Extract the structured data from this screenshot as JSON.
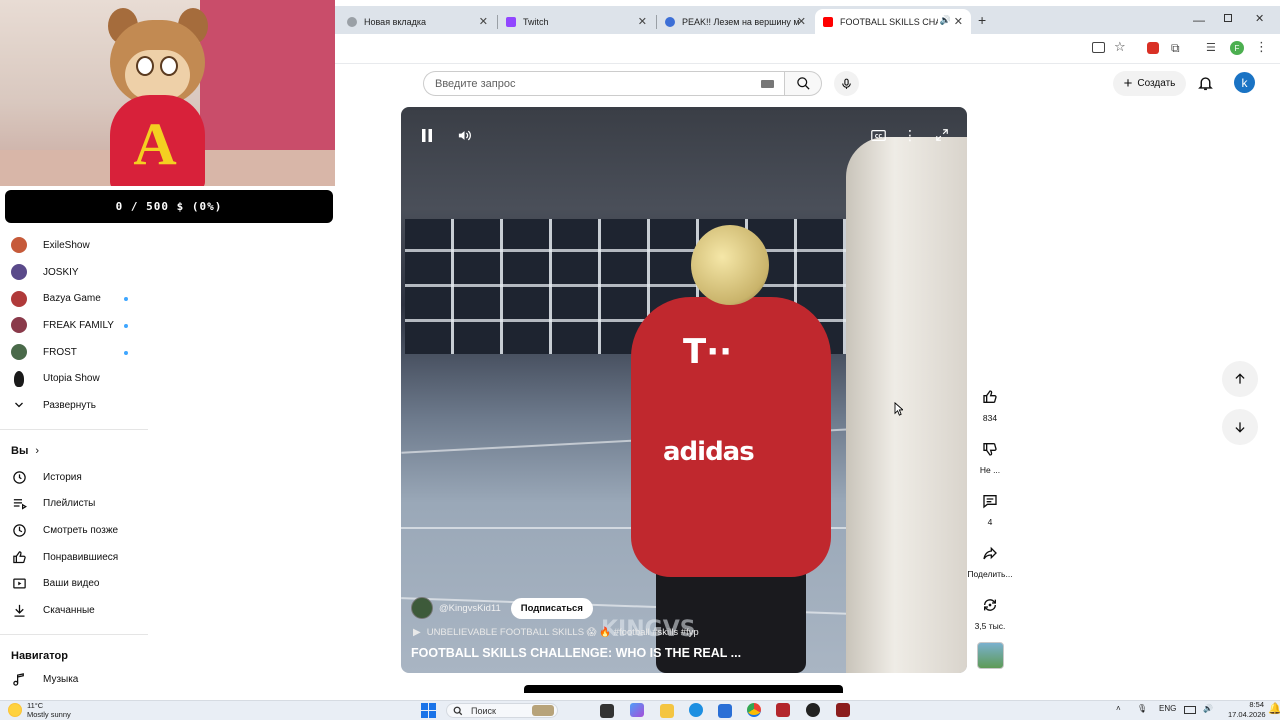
{
  "overlay": {
    "donation_text": "0 / 500 $ (0%)"
  },
  "browser": {
    "tabs": [
      {
        "label": "Новая вкладка",
        "favicon": "chrome-icon",
        "color": "#4285f4",
        "active": false
      },
      {
        "label": "Twitch",
        "favicon": "twitch-icon",
        "color": "#9146ff",
        "active": false
      },
      {
        "label": "PEAK!! Лезем на вершину мед",
        "favicon": "r-icon",
        "color": "#3d6fd6",
        "active": false
      },
      {
        "label": "FOOTBALL SKILLS CHALLE",
        "favicon": "youtube-icon",
        "color": "#ff0000",
        "active": true
      }
    ],
    "new_tab": "+",
    "profile_initial": "F"
  },
  "youtube": {
    "search_placeholder": "Введите запрос",
    "create_label": "Создать",
    "account_initial": "k"
  },
  "sidebar": {
    "subscriptions": [
      {
        "name": "ExileShow",
        "color": "#c65a3a",
        "live": false
      },
      {
        "name": "JOSKIY",
        "color": "#5a4a8a",
        "live": false
      },
      {
        "name": "Bazya Game",
        "color": "#b03a3a",
        "live": true
      },
      {
        "name": "FREAK FAMILY",
        "color": "#8a3a4a",
        "live": true
      },
      {
        "name": "FROST",
        "color": "#4a6a4a",
        "live": true
      },
      {
        "name": "Utopia Show",
        "color": "#1a1a1a",
        "live": false
      }
    ],
    "expand_label": "Развернуть",
    "you_header": "Вы",
    "you_items": [
      {
        "label": "История",
        "icon": "history-icon"
      },
      {
        "label": "Плейлисты",
        "icon": "playlists-icon"
      },
      {
        "label": "Смотреть позже",
        "icon": "watch-later-icon"
      },
      {
        "label": "Понравившиеся",
        "icon": "like-icon"
      },
      {
        "label": "Ваши видео",
        "icon": "your-videos-icon"
      },
      {
        "label": "Скачанные",
        "icon": "download-icon"
      }
    ],
    "navigator_header": "Навигатор",
    "navigator_items": [
      {
        "label": "Музыка",
        "icon": "music-icon"
      }
    ]
  },
  "video": {
    "channel_handle": "@KingvsKid11",
    "subscribe_label": "Подписаться",
    "track_text": "UNBELIEVABLE FOOTBALL SKILLS 😱 🔥 #football #skills #fyp",
    "title": "FOOTBALL SKILLS CHALLENGE: WHO IS THE REAL ...",
    "watermark": "KINGVS"
  },
  "actions": {
    "likes": "834",
    "dislike_label": "Не ...",
    "comments": "4",
    "share_label": "Поделить...",
    "remix_count": "3,5 тыс."
  },
  "taskbar": {
    "temperature": "11°C",
    "weather": "Mostly sunny",
    "search_label": "Поиск",
    "lang": "ENG",
    "time": "8:54",
    "date": "17.04.2026"
  }
}
